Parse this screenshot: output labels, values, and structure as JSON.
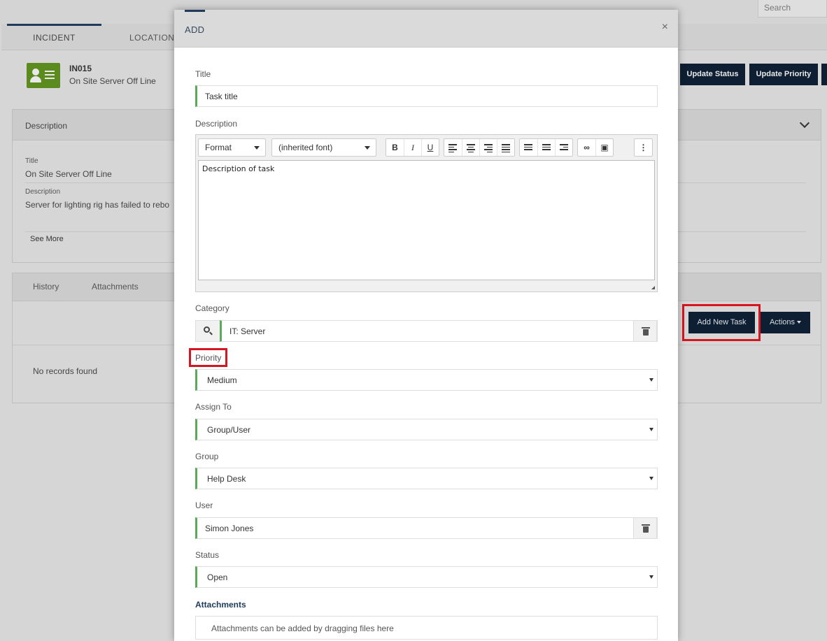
{
  "header": {
    "search_placeholder": "Search"
  },
  "tabs": [
    {
      "label": "INCIDENT"
    },
    {
      "label": "LOCATION"
    }
  ],
  "incident": {
    "id": "IN015",
    "title": "On Site Server Off Line"
  },
  "header_actions": {
    "update_status": "Update Status",
    "update_priority": "Update Priority"
  },
  "description_panel": {
    "heading": "Description",
    "title_label": "Title",
    "title_value": "On Site Server Off Line",
    "description_label": "Description",
    "description_value": "Server for lighting rig has failed to rebo",
    "see_more": "See More"
  },
  "tasks_panel": {
    "tabs": [
      {
        "label": "History"
      },
      {
        "label": "Attachments"
      }
    ],
    "add_new_task": "Add New Task",
    "actions": "Actions",
    "empty_message": "No records found"
  },
  "modal": {
    "title": "ADD",
    "close": "×",
    "title_field": {
      "label": "Title",
      "value": "Task title"
    },
    "description_field": {
      "label": "Description",
      "format_dropdown": "Format",
      "font_dropdown": "(inherited font)",
      "bold": "B",
      "italic": "I",
      "underline": "U",
      "more": "⋮",
      "content": "Description of task"
    },
    "category_field": {
      "label": "Category",
      "value": "IT: Server"
    },
    "priority_field": {
      "label": "Priority",
      "value": "Medium"
    },
    "assign_to_field": {
      "label": "Assign To",
      "value": "Group/User"
    },
    "group_field": {
      "label": "Group",
      "value": "Help Desk"
    },
    "user_field": {
      "label": "User",
      "value": "Simon Jones"
    },
    "status_field": {
      "label": "Status",
      "value": "Open"
    },
    "attachments": {
      "heading": "Attachments",
      "drop_hint": "Attachments can be added by dragging files here"
    }
  },
  "colors": {
    "accent_navy": "#0e1f33",
    "field_accent_green": "#5aaa5a",
    "highlight_red": "#d5151f",
    "incident_icon_green": "#5b8b1e"
  }
}
